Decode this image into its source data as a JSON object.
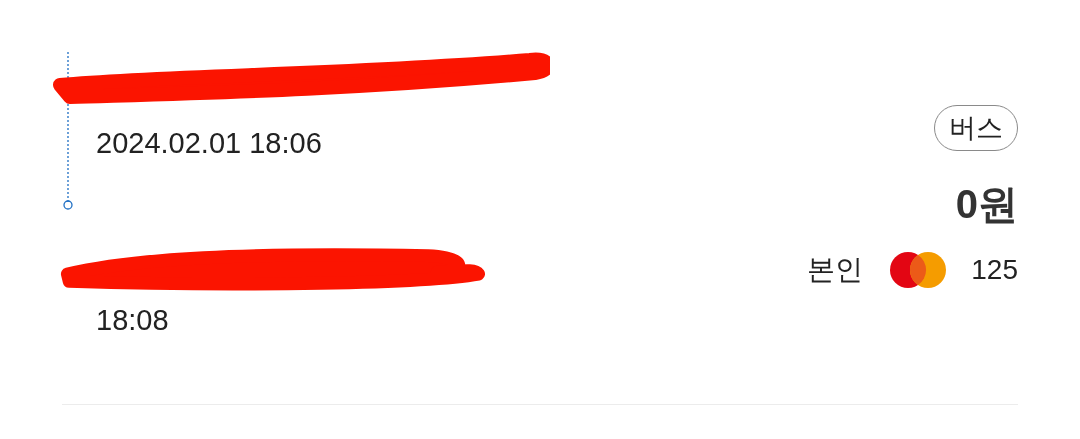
{
  "trip": {
    "stops": [
      {
        "time": "2024.02.01 18:06"
      },
      {
        "time": "18:08"
      }
    ],
    "mode_badge": "버스",
    "fare": "0원",
    "payer": "본인",
    "card_number": "125"
  }
}
